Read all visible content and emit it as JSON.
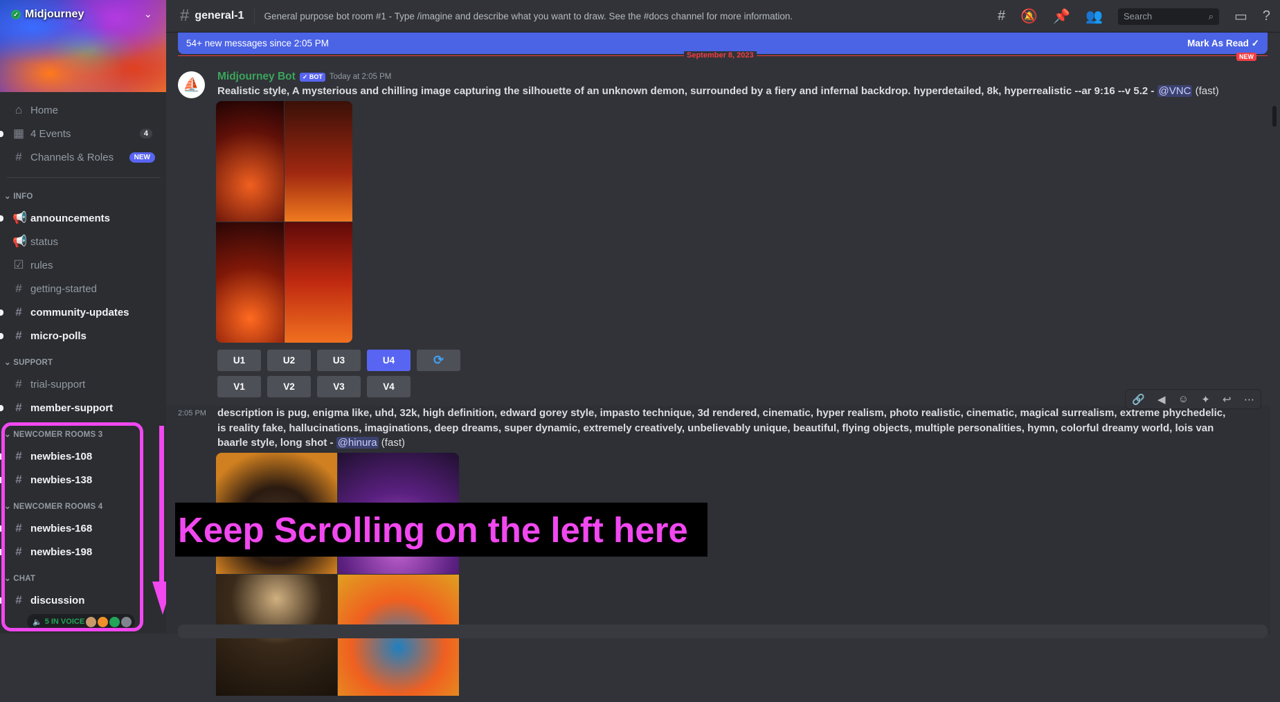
{
  "server": {
    "name": "Midjourney"
  },
  "sidebar": {
    "top": [
      {
        "label": "Home",
        "icon": "home-icon"
      },
      {
        "label": "4 Events",
        "icon": "calendar-icon",
        "count": "4"
      },
      {
        "label": "Channels & Roles",
        "icon": "channels-icon",
        "badge": "NEW"
      }
    ],
    "categories": [
      {
        "name": "INFO",
        "channels": [
          {
            "label": "announcements",
            "unread": true
          },
          {
            "label": "status"
          },
          {
            "label": "rules"
          },
          {
            "label": "getting-started"
          },
          {
            "label": "community-updates",
            "unread": true
          },
          {
            "label": "micro-polls",
            "unread": true
          }
        ]
      },
      {
        "name": "SUPPORT",
        "channels": [
          {
            "label": "trial-support"
          },
          {
            "label": "member-support",
            "unread": true
          }
        ]
      },
      {
        "name": "NEWCOMER ROOMS 3",
        "channels": [
          {
            "label": "newbies-108",
            "unread": true
          },
          {
            "label": "newbies-138",
            "unread": true
          }
        ]
      },
      {
        "name": "NEWCOMER ROOMS 4",
        "channels": [
          {
            "label": "newbies-168",
            "unread": true
          },
          {
            "label": "newbies-198",
            "unread": true
          }
        ]
      },
      {
        "name": "CHAT",
        "channels": [
          {
            "label": "discussion",
            "unread": true
          }
        ]
      }
    ],
    "voice": "5 IN VOICE"
  },
  "header": {
    "channel": "general-1",
    "topic": "General purpose bot room #1 - Type /imagine and describe what you want to draw. See the #docs channel for more information.",
    "search_placeholder": "Search"
  },
  "banner": {
    "text": "54+ new messages since 2:05 PM",
    "action": "Mark As Read"
  },
  "divider": {
    "date": "September 8, 2023",
    "new": "NEW"
  },
  "messages": [
    {
      "author": "Midjourney Bot",
      "badge": "✓ BOT",
      "time": "Today at 2:05 PM",
      "text": "Realistic style, A mysterious and chilling image capturing the silhouette of an unknown demon, surrounded by a fiery and infernal backdrop. hyperdetailed, 8k, hyperrealistic --ar 9:16 --v 5.2 - ",
      "mention": "@VNC",
      "suffix": " (fast)",
      "buttons_row1": [
        "U1",
        "U2",
        "U3",
        "U4"
      ],
      "buttons_row2": [
        "V1",
        "V2",
        "V3",
        "V4"
      ],
      "selected": "U4"
    },
    {
      "time": "2:05 PM",
      "text": "description is pug, enigma like, uhd, 32k, high definition, edward gorey style, impasto technique, 3d rendered, cinematic, hyper realism, photo realistic, cinematic, magical surrealism, extreme phychedelic, is reality fake, hallucinations, imaginations, deep dreams, super dynamic, extremely creatively, unbelievably unique, beautiful, flying objects, multiple personalities, hymn, colorful dreamy world, lois van baarle style, long shot - ",
      "mention": "@hinura",
      "suffix": " (fast)"
    }
  ],
  "overlay": {
    "text": "Keep Scrolling on the left here",
    "color": "#f148f0"
  },
  "colors": {
    "accent": "#5865f2",
    "banner": "#4b63e5",
    "bot_name": "#3ba55c",
    "new_line": "#f23f43"
  }
}
